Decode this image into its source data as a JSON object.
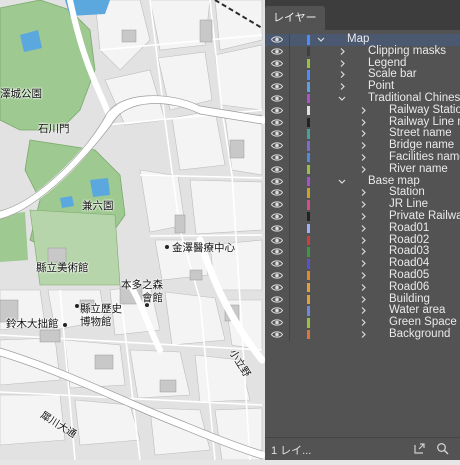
{
  "panel": {
    "tab_label": "レイヤー",
    "footer_count": "1 レイ..."
  },
  "colors": {
    "park": "#9ec990",
    "block": "#f4f4f4",
    "road": "#ffffff",
    "building": "#c8c8c8",
    "water": "#5aa8de",
    "panel_bg": "#535353",
    "selection": "#4a5870"
  },
  "map_labels": [
    {
      "text": "澤城公園",
      "kind": "place"
    },
    {
      "text": "石川門",
      "kind": "place"
    },
    {
      "text": "兼六園",
      "kind": "place"
    },
    {
      "text": "金澤醫療中心",
      "kind": "place"
    },
    {
      "text": "縣立美術館",
      "kind": "place"
    },
    {
      "text": "本多之森",
      "kind": "place"
    },
    {
      "text": "會館",
      "kind": "place"
    },
    {
      "text": "縣立歷史",
      "kind": "place"
    },
    {
      "text": "博物館",
      "kind": "place"
    },
    {
      "text": "鈴木大拙館",
      "kind": "place"
    },
    {
      "text": "犀川大通",
      "kind": "road"
    },
    {
      "text": "小立野",
      "kind": "road"
    }
  ],
  "layers": [
    {
      "name": "Map",
      "level": 0,
      "expanded": true,
      "selected": true,
      "color": "#4d8cff"
    },
    {
      "name": "Clipping masks",
      "level": 1,
      "expanded": false,
      "color": "#404040"
    },
    {
      "name": "Legend",
      "level": 1,
      "expanded": false,
      "color": "#9ac23c"
    },
    {
      "name": "Scale bar",
      "level": 1,
      "expanded": false,
      "color": "#4d8cff"
    },
    {
      "name": "Point",
      "level": 1,
      "expanded": false,
      "color": "#5aa0e6"
    },
    {
      "name": "Traditional Chinese",
      "level": 1,
      "expanded": true,
      "color": "#b04fd6"
    },
    {
      "name": "Railway Station",
      "level": 2,
      "expanded": false,
      "color": "#e0e0e0"
    },
    {
      "name": "Railway Line na",
      "level": 2,
      "expanded": false,
      "color": "#222222"
    },
    {
      "name": "Street name",
      "level": 2,
      "expanded": false,
      "color": "#3fa79a"
    },
    {
      "name": "Bridge name",
      "level": 2,
      "expanded": false,
      "color": "#7a6cd6"
    },
    {
      "name": "Facilities name",
      "level": 2,
      "expanded": false,
      "color": "#4f8be0"
    },
    {
      "name": "River name",
      "level": 2,
      "expanded": false,
      "color": "#9ac23c"
    },
    {
      "name": "Base map",
      "level": 1,
      "expanded": true,
      "color": "#a84fd6"
    },
    {
      "name": "Station",
      "level": 2,
      "expanded": false,
      "color": "#c9a227"
    },
    {
      "name": "JR Line",
      "level": 2,
      "expanded": false,
      "color": "#d94b8c"
    },
    {
      "name": "Private Railway",
      "level": 2,
      "expanded": false,
      "color": "#222222"
    },
    {
      "name": "Road01",
      "level": 2,
      "expanded": false,
      "color": "#9bb0ff"
    },
    {
      "name": "Road02",
      "level": 2,
      "expanded": false,
      "color": "#d83a3a"
    },
    {
      "name": "Road03",
      "level": 2,
      "expanded": false,
      "color": "#3a9a44"
    },
    {
      "name": "Road04",
      "level": 2,
      "expanded": false,
      "color": "#5a4fd6"
    },
    {
      "name": "Road05",
      "level": 2,
      "expanded": false,
      "color": "#e38a2c"
    },
    {
      "name": "Road06",
      "level": 2,
      "expanded": false,
      "color": "#e0a13a"
    },
    {
      "name": "Building",
      "level": 2,
      "expanded": false,
      "color": "#e0a13a"
    },
    {
      "name": "Water area",
      "level": 2,
      "expanded": false,
      "color": "#6a8ae0"
    },
    {
      "name": "Green Space",
      "level": 2,
      "expanded": false,
      "color": "#9ac23c"
    },
    {
      "name": "Background",
      "level": 2,
      "expanded": false,
      "color": "#e0733a"
    }
  ]
}
